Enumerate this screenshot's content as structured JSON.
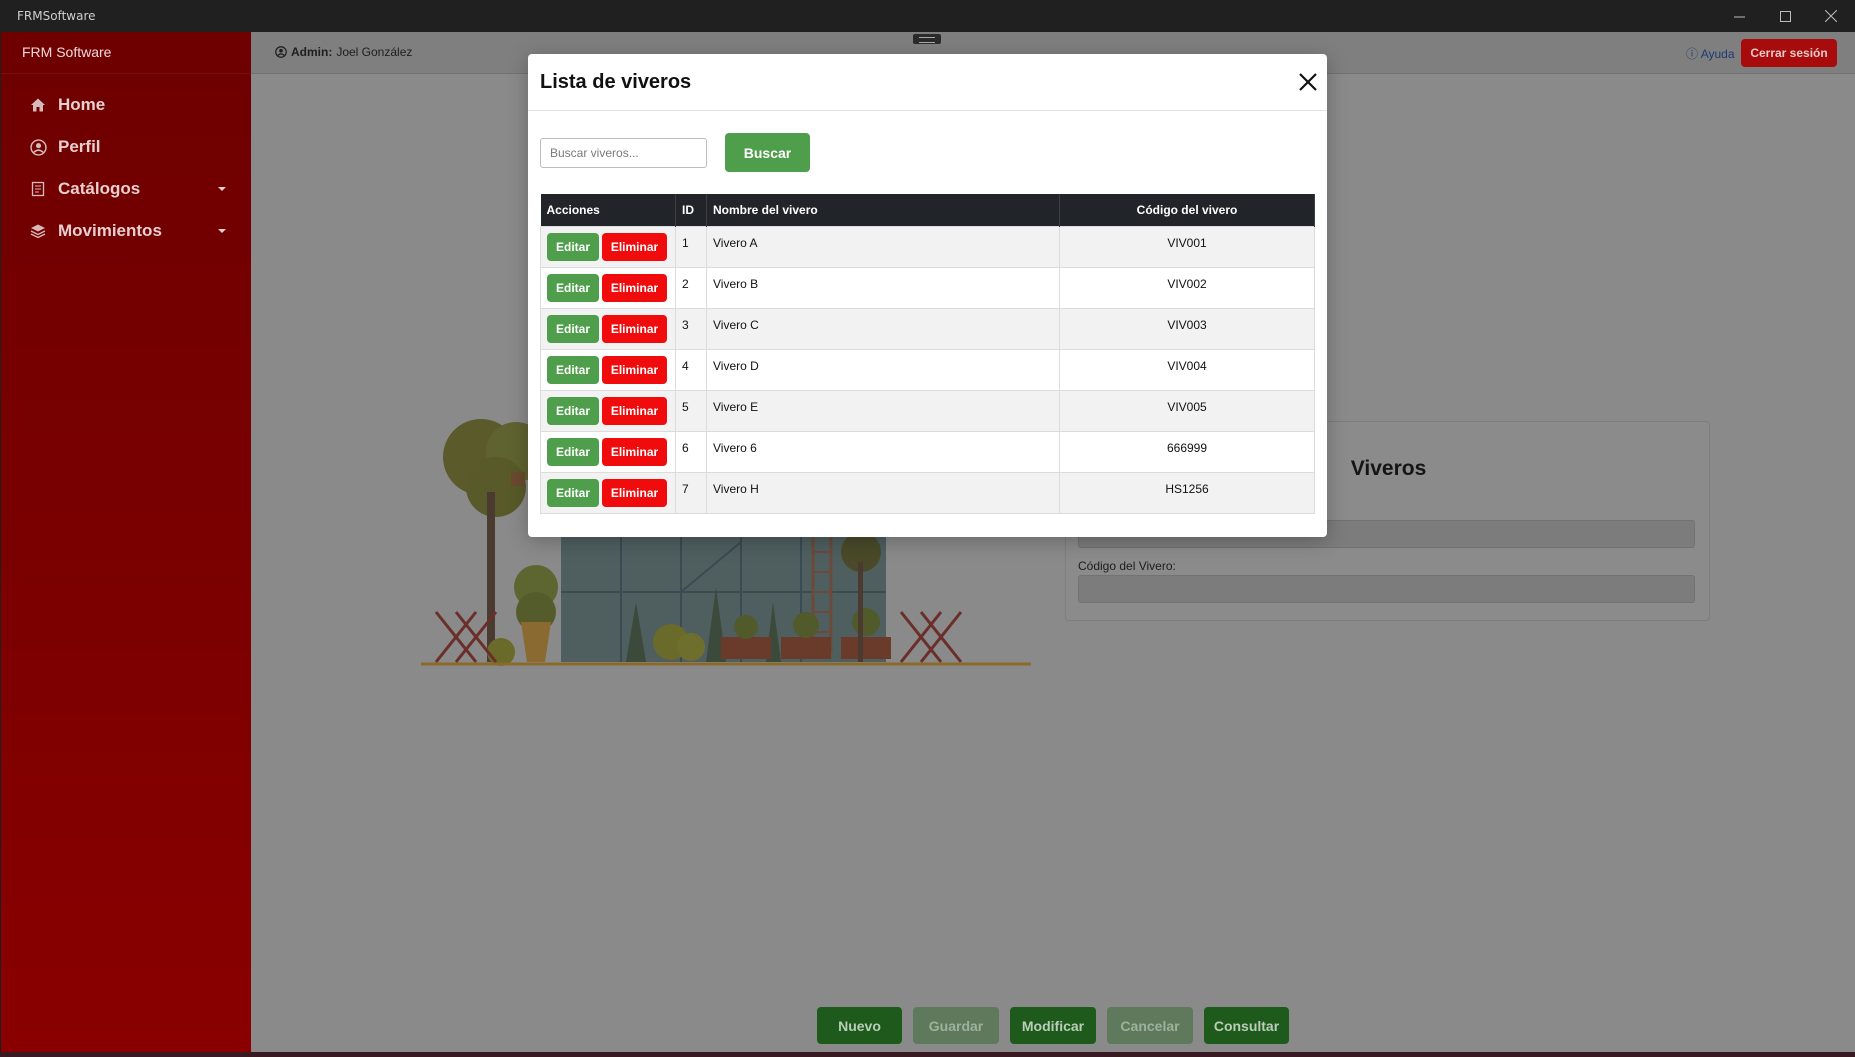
{
  "window": {
    "title": "FRMSoftware"
  },
  "sidebar": {
    "brand": "FRM Software",
    "items": [
      {
        "label": "Home",
        "icon": "home-icon"
      },
      {
        "label": "Perfil",
        "icon": "user-circle-icon"
      },
      {
        "label": "Catálogos",
        "icon": "catalog-icon",
        "has_submenu": true
      },
      {
        "label": "Movimientos",
        "icon": "layers-icon",
        "has_submenu": true
      }
    ]
  },
  "topbar": {
    "admin_label": "Admin:",
    "admin_name": "Joel González",
    "help_label": "Ayuda",
    "logout_label": "Cerrar sesión"
  },
  "form": {
    "title": "Viveros",
    "code_label": "Código del Vivero:"
  },
  "actions": {
    "nuevo": "Nuevo",
    "guardar": "Guardar",
    "modificar": "Modificar",
    "cancelar": "Cancelar",
    "consultar": "Consultar"
  },
  "modal": {
    "title": "Lista de viveros",
    "search_placeholder": "Buscar viveros...",
    "search_button": "Buscar",
    "columns": [
      "Acciones",
      "ID",
      "Nombre del vivero",
      "Código del vivero"
    ],
    "edit_label": "Editar",
    "delete_label": "Eliminar",
    "rows": [
      {
        "id": "1",
        "name": "Vivero A",
        "code": "VIV001"
      },
      {
        "id": "2",
        "name": "Vivero B",
        "code": "VIV002"
      },
      {
        "id": "3",
        "name": "Vivero C",
        "code": "VIV003"
      },
      {
        "id": "4",
        "name": "Vivero D",
        "code": "VIV004"
      },
      {
        "id": "5",
        "name": "Vivero E",
        "code": "VIV005"
      },
      {
        "id": "6",
        "name": "Vivero 6",
        "code": "666999"
      },
      {
        "id": "7",
        "name": "Vivero H",
        "code": "HS1256"
      }
    ]
  },
  "colors": {
    "sidebar": "#7a0000",
    "success": "#4f9e4b",
    "danger": "#f00c0c",
    "table_header": "#212529"
  }
}
